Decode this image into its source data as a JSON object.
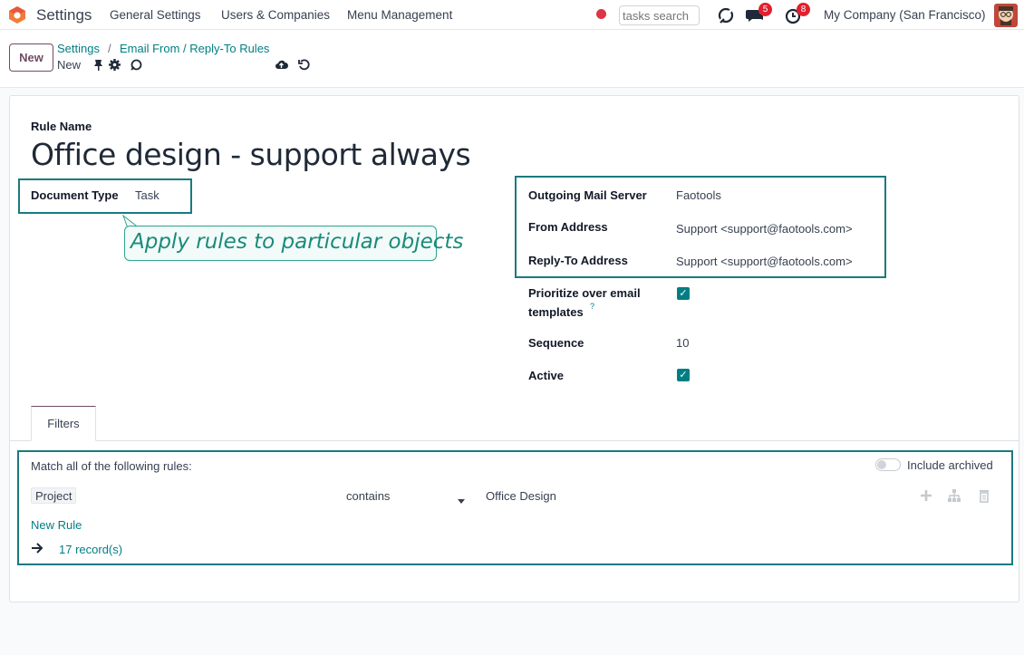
{
  "navbar": {
    "app_name": "Settings",
    "menu": [
      "General Settings",
      "Users & Companies",
      "Menu Management"
    ],
    "search_placeholder": "tasks search",
    "messages_badge": "5",
    "activities_badge": "8",
    "company": "My Company (San Francisco)"
  },
  "control": {
    "new_button": "New",
    "breadcrumb": [
      "Settings",
      "Email From / Reply-To Rules"
    ],
    "breadcrumb_separator": "/",
    "record_status": "New"
  },
  "form": {
    "rule_name_label": "Rule Name",
    "rule_name": "Office design - support always",
    "document_type_label": "Document Type",
    "document_type": "Task",
    "tooltip": "Apply rules to particular objects",
    "outgoing_server_label": "Outgoing Mail Server",
    "outgoing_server": "Faotools",
    "from_label": "From Address",
    "from_value": "Support <support@faotools.com>",
    "reply_to_label": "Reply-To Address",
    "reply_to_value": "Support <support@faotools.com>",
    "prioritize_label_1": "Prioritize over email",
    "prioritize_label_2": "templates",
    "help_mark": "?",
    "prioritize_checked": true,
    "sequence_label": "Sequence",
    "sequence": "10",
    "active_label": "Active",
    "active_checked": true
  },
  "tabs": [
    "Filters"
  ],
  "filters": {
    "match_text": "Match all of the following rules:",
    "include_archived": "Include archived",
    "field": "Project",
    "operator": "contains",
    "value": "Office Design",
    "new_rule": "New Rule",
    "records": "17 record(s)"
  },
  "colors": {
    "brand": "#714b67",
    "accent": "#017e84",
    "highlight_border": "#1a7a7f",
    "badge": "#e0202f"
  }
}
